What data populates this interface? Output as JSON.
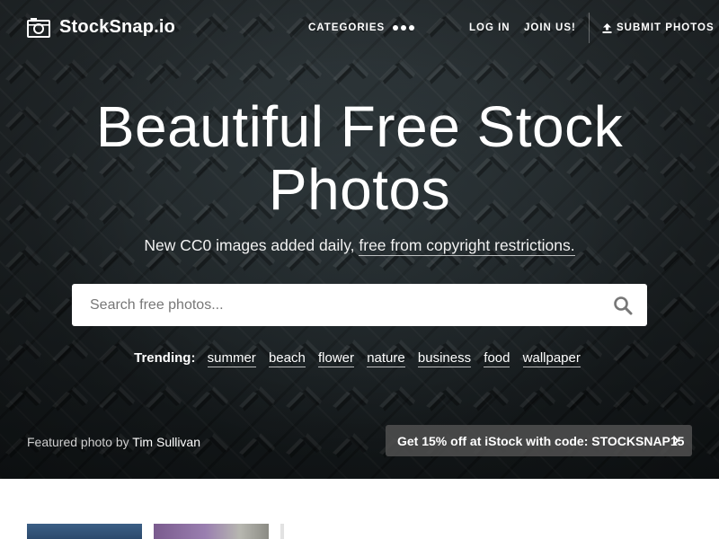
{
  "brand": {
    "name": "StockSnap.io",
    "logo_icon": "camera-icon"
  },
  "nav": {
    "categories": "CATEGORIES",
    "more_icon": "more-dots-icon",
    "login": "LOG IN",
    "join": "JOIN US!",
    "submit": "SUBMIT PHOTOS",
    "submit_icon": "upload-icon"
  },
  "hero": {
    "headline_line1": "Beautiful Free Stock",
    "headline_line2": "Photos",
    "subline_prefix": "New CC0 images added daily, ",
    "subline_link": "free from copyright restrictions."
  },
  "search": {
    "placeholder": "Search free photos...",
    "value": "",
    "icon": "search-icon"
  },
  "trending": {
    "label": "Trending:",
    "tags": [
      "summer",
      "beach",
      "flower",
      "nature",
      "business",
      "food",
      "wallpaper"
    ]
  },
  "featured": {
    "prefix": "Featured photo by ",
    "author": "Tim Sullivan"
  },
  "promo": {
    "label": "Get 15% off at iStock with code: STOCKSNAP15",
    "icon": "chevron-right-icon"
  },
  "colors": {
    "hero_bg": "#1c2326",
    "text": "#ffffff",
    "promo_bg": "#505050"
  }
}
